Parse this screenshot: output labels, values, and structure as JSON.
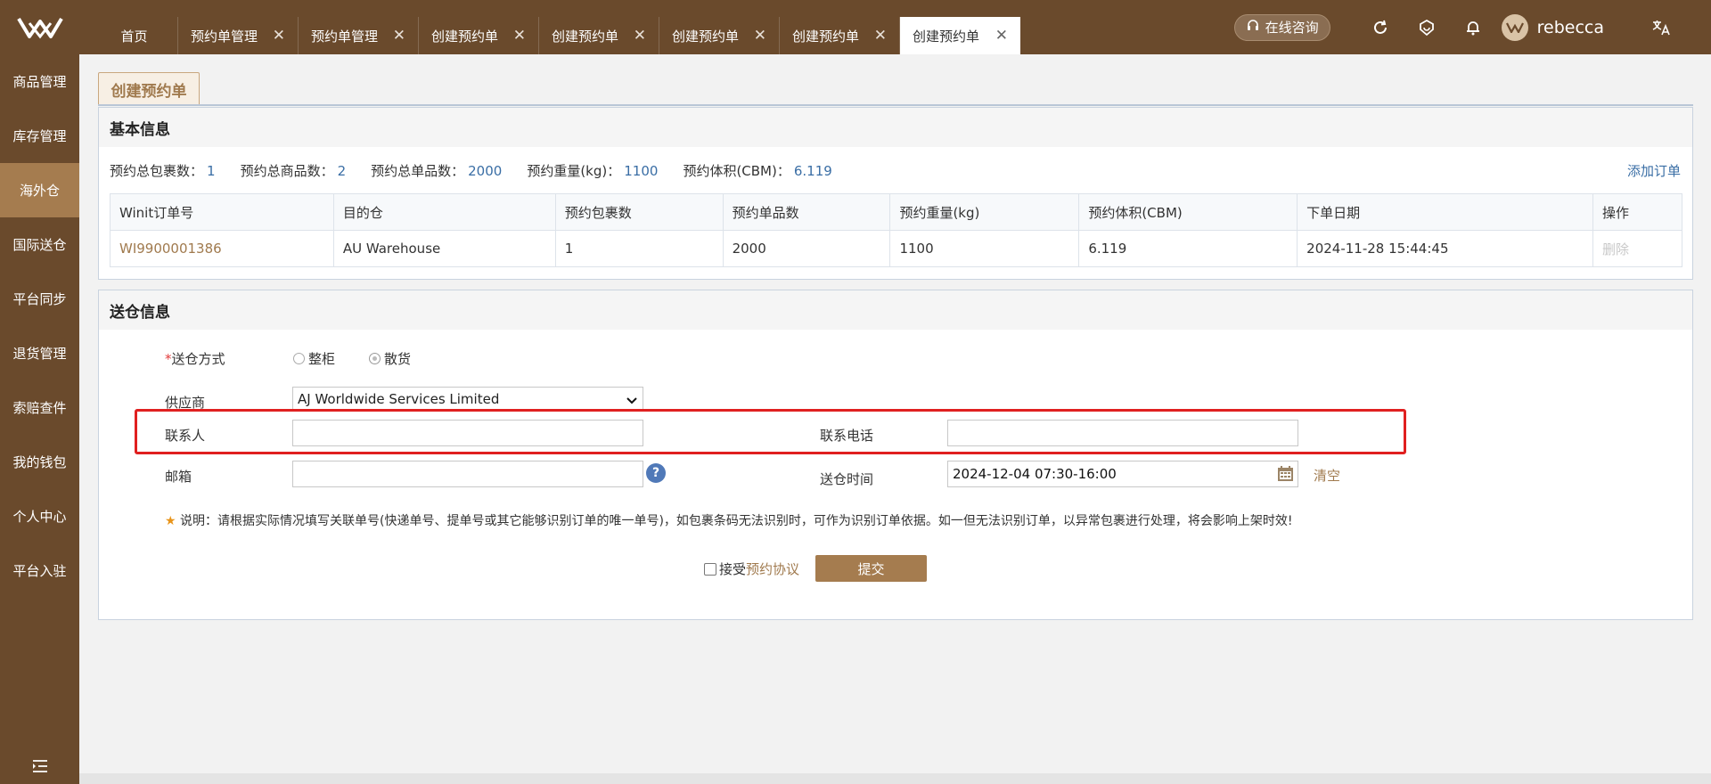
{
  "app": {
    "logo": "W"
  },
  "tabs": [
    {
      "label": "首页"
    },
    {
      "label": "预约单管理"
    },
    {
      "label": "预约单管理"
    },
    {
      "label": "创建预约单"
    },
    {
      "label": "创建预约单"
    },
    {
      "label": "创建预约单"
    },
    {
      "label": "创建预约单"
    },
    {
      "label": "创建预约单",
      "active": true
    }
  ],
  "header": {
    "consult_label": "在线咨询",
    "username": "rebecca",
    "icons": [
      "refresh-icon",
      "smile-icon",
      "bell-icon",
      "translate-icon"
    ]
  },
  "sidebar": {
    "items": [
      {
        "label": "商品管理"
      },
      {
        "label": "库存管理"
      },
      {
        "label": "海外仓",
        "active": true
      },
      {
        "label": "国际送仓"
      },
      {
        "label": "平台同步"
      },
      {
        "label": "退货管理"
      },
      {
        "label": "索赔查件"
      },
      {
        "label": "我的钱包"
      },
      {
        "label": "个人中心"
      },
      {
        "label": "平台入驻"
      }
    ]
  },
  "page": {
    "title": "创建预约单"
  },
  "basic_info": {
    "title": "基本信息",
    "summary": [
      {
        "label": "预约总包裹数：",
        "value": "1"
      },
      {
        "label": "预约总商品数：",
        "value": "2"
      },
      {
        "label": "预约总单品数：",
        "value": "2000"
      },
      {
        "label": "预约重量(kg)：",
        "value": "1100"
      },
      {
        "label": "预约体积(CBM)：",
        "value": "6.119"
      }
    ],
    "add_order_label": "添加订单",
    "table": {
      "headers": [
        "Winit订单号",
        "目的仓",
        "预约包裹数",
        "预约单品数",
        "预约重量(kg)",
        "预约体积(CBM)",
        "下单日期",
        "操作"
      ],
      "rows": [
        [
          "WI9900001386",
          "AU Warehouse",
          "1",
          "2000",
          "1100",
          "6.119",
          "2024-11-28 15:44:45",
          "删除"
        ]
      ]
    }
  },
  "delivery": {
    "title": "送仓信息",
    "method_label": "送仓方式",
    "required_mark": "*",
    "method_options": [
      {
        "label": "整柜",
        "selected": false
      },
      {
        "label": "散货",
        "selected": true
      }
    ],
    "supplier_label": "供应商",
    "supplier_value": "AJ Worldwide Services Limited",
    "contact_label": "联系人",
    "contact_value": "",
    "phone_label": "联系电话",
    "phone_value": "",
    "email_label": "邮箱",
    "email_value": "",
    "email_help": "?",
    "time_label": "送仓时间",
    "time_value": "2024-12-04 07:30-16:00",
    "clear_label": "清空",
    "note_star": "★",
    "note": "说明：请根据实际情况填写关联单号(快递单号、提单号或其它能够识别订单的唯一单号)，如包裹条码无法识别时，可作为识别订单依据。如一但无法识别订单，以异常包裹进行处理，将会影响上架时效!",
    "agree_prefix": "接受",
    "agree_link": "预约协议",
    "submit_label": "提交"
  },
  "colors": {
    "brand": "#6a4a2c",
    "accent": "#a57c4f",
    "highlight": "#e02020",
    "link": "#3a6ea5"
  }
}
